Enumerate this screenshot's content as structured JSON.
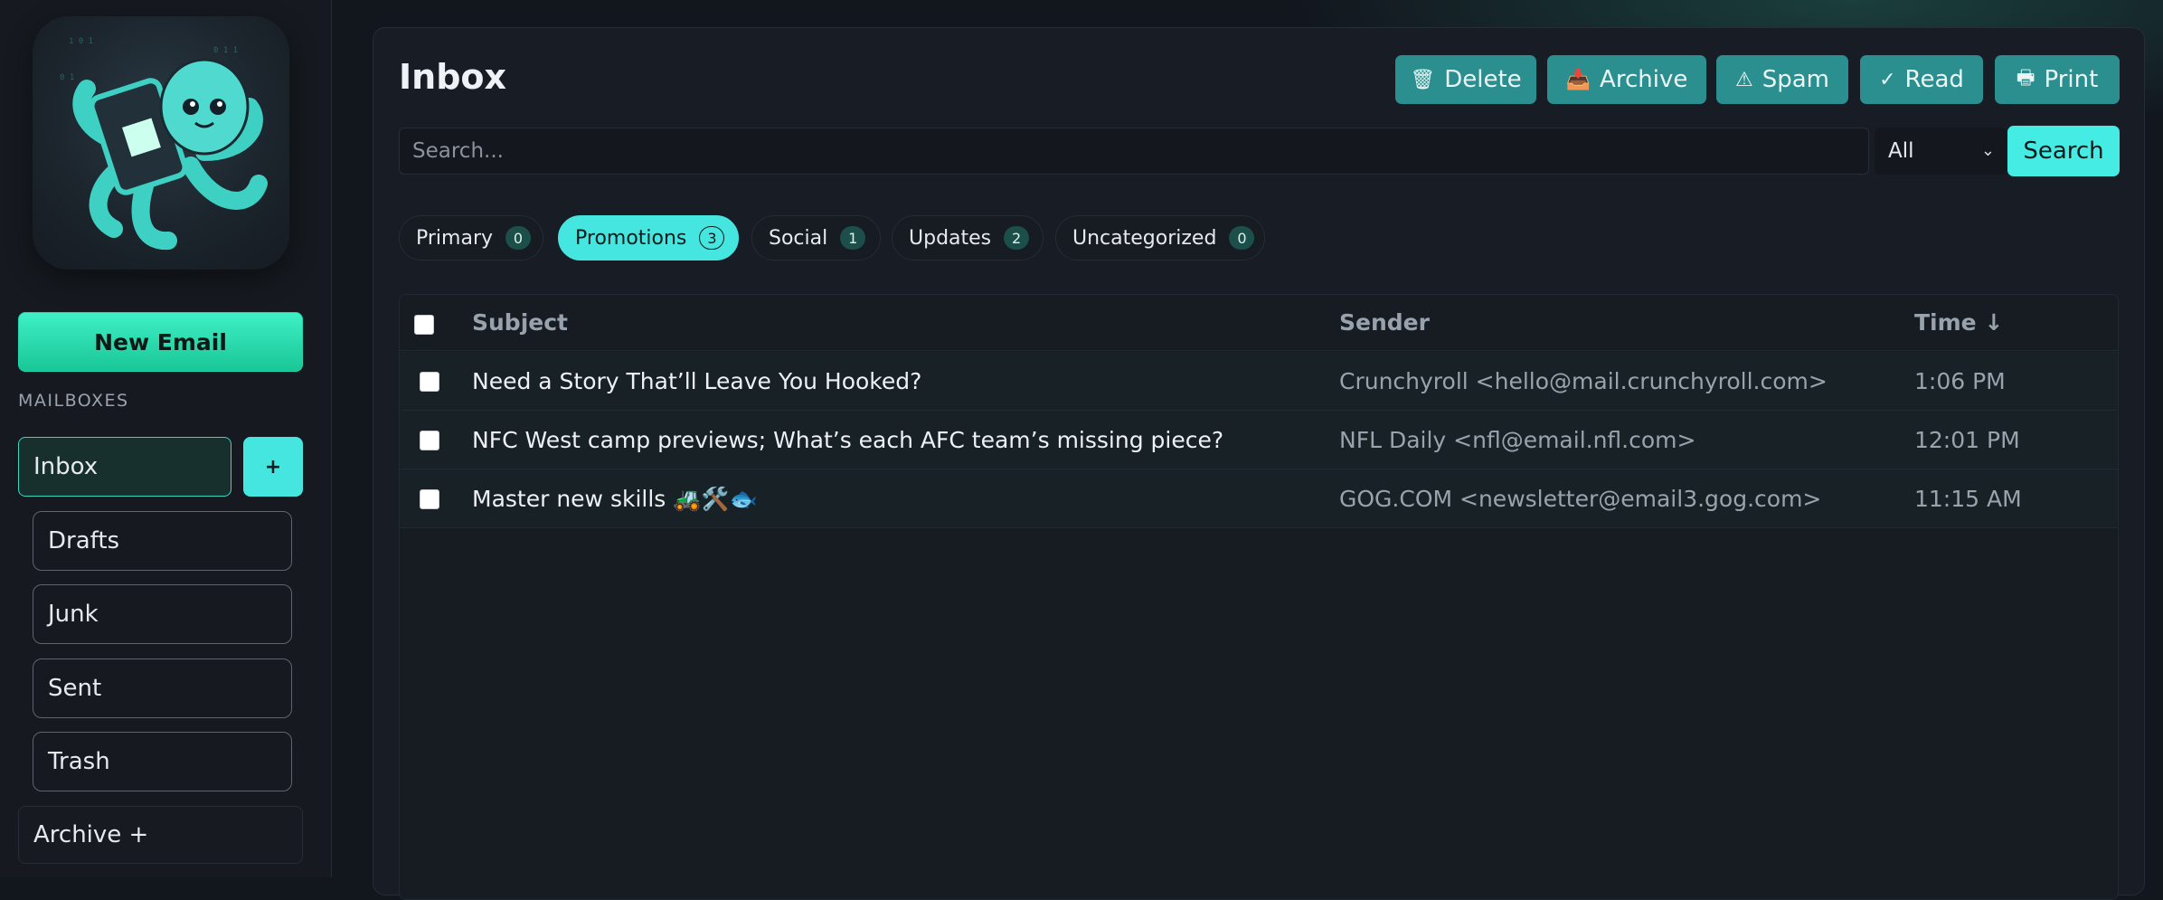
{
  "sidebar": {
    "new_email_label": "New Email",
    "mailboxes_label": "MAILBOXES",
    "inbox_label": "Inbox",
    "add_label": "+",
    "folders": [
      "Drafts",
      "Junk",
      "Sent",
      "Trash"
    ],
    "archive_label": "Archive +"
  },
  "main": {
    "title": "Inbox",
    "toolbar": [
      {
        "icon": "trash-icon",
        "glyph": "🗑",
        "label": "Delete"
      },
      {
        "icon": "archive-icon",
        "glyph": "📥",
        "label": "Archive"
      },
      {
        "icon": "warning-icon",
        "glyph": "⚠",
        "label": "Spam"
      },
      {
        "icon": "check-icon",
        "glyph": "✓",
        "label": "Read"
      },
      {
        "icon": "printer-icon",
        "glyph": "🖶",
        "label": "Print"
      }
    ],
    "search": {
      "placeholder": "Search...",
      "filter_value": "All",
      "button_label": "Search"
    },
    "tabs": [
      {
        "label": "Primary",
        "count": "0",
        "active": false
      },
      {
        "label": "Promotions",
        "count": "3",
        "active": true
      },
      {
        "label": "Social",
        "count": "1",
        "active": false
      },
      {
        "label": "Updates",
        "count": "2",
        "active": false
      },
      {
        "label": "Uncategorized",
        "count": "0",
        "active": false
      }
    ],
    "table": {
      "headers": {
        "subject": "Subject",
        "sender": "Sender",
        "time": "Time ↓"
      },
      "rows": [
        {
          "subject": "Need a Story That’ll Leave You Hooked?",
          "sender": "Crunchyroll <hello@mail.crunchyroll.com>",
          "time": "1:06 PM"
        },
        {
          "subject": "NFC West camp previews; What’s each AFC team’s missing piece?",
          "sender": "NFL Daily <nfl@email.nfl.com>",
          "time": "12:01 PM"
        },
        {
          "subject": "Master new skills 🚜🛠️🐟",
          "sender": "GOG.COM <newsletter@email3.gog.com>",
          "time": "11:15 AM"
        }
      ]
    }
  },
  "colors": {
    "accent": "#45e6e0",
    "toolbar_button": "#2b8f8f",
    "new_email": "#2fe3b4",
    "background": "#12161d"
  }
}
